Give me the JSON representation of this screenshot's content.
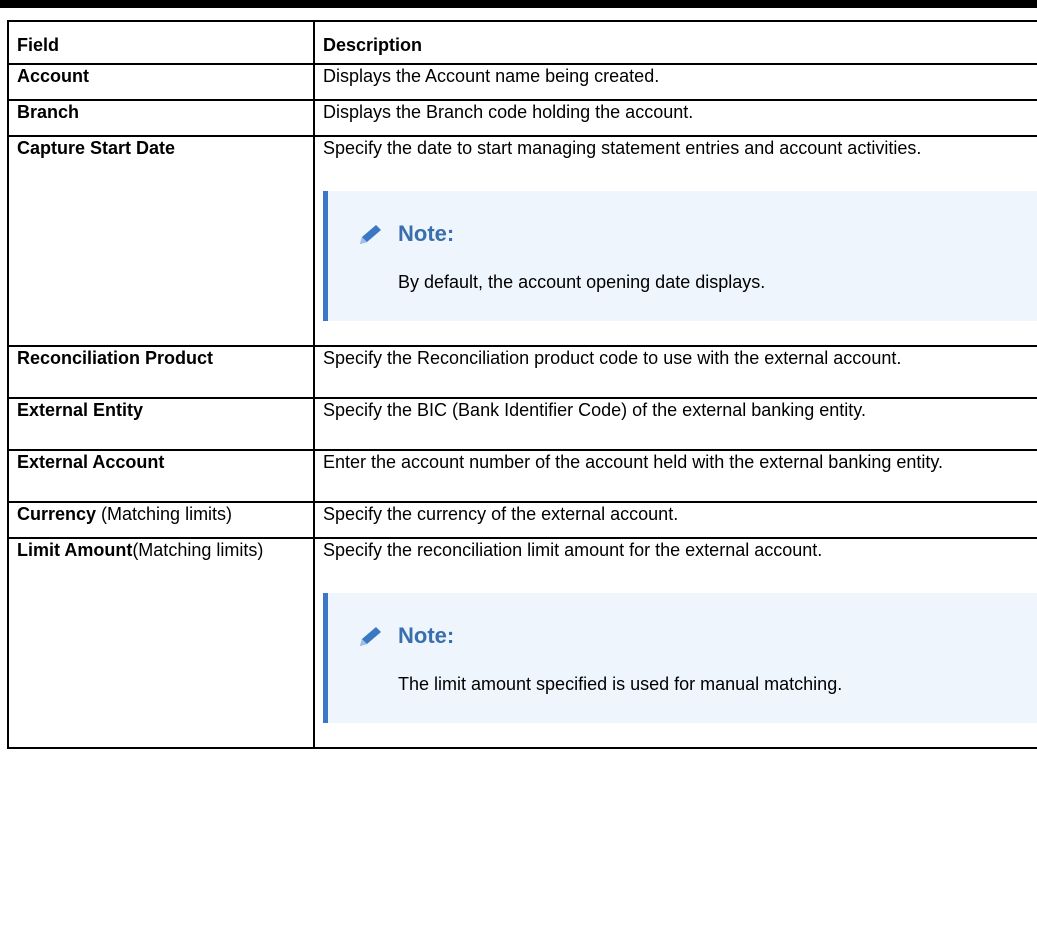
{
  "table": {
    "headers": {
      "field": "Field",
      "description": "Description"
    },
    "rows": [
      {
        "field": "Account",
        "description": "Displays the Account name being created."
      },
      {
        "field": "Branch",
        "description": "Displays the Branch code holding the account."
      },
      {
        "field": "Capture Start Date",
        "description": "Specify the date to start managing statement entries and account activities.",
        "note": {
          "title": "Note:",
          "text": "By default, the account opening date displays."
        }
      },
      {
        "field": "Reconciliation Product",
        "description": "Specify the Reconciliation product code to use with the external account."
      },
      {
        "field": "External Entity",
        "description": "Specify the BIC (Bank Identifier Code) of the external banking entity."
      },
      {
        "field": "External Account",
        "description": "Enter the account number of the account held with the external banking entity."
      },
      {
        "field": "Currency",
        "field_suffix": " (Matching limits)",
        "description": "Specify the currency of the external account."
      },
      {
        "field": "Limit Amount",
        "field_suffix": "(Matching limits)",
        "description": "Specify the reconciliation limit amount for the external account.",
        "note": {
          "title": "Note:",
          "text": "The limit amount specified is used for manual matching."
        }
      }
    ]
  },
  "colors": {
    "note_accent": "#3b78c4",
    "note_background": "#eef5fc",
    "note_title": "#3a6fae"
  },
  "icons": {
    "note": "pencil-icon"
  }
}
